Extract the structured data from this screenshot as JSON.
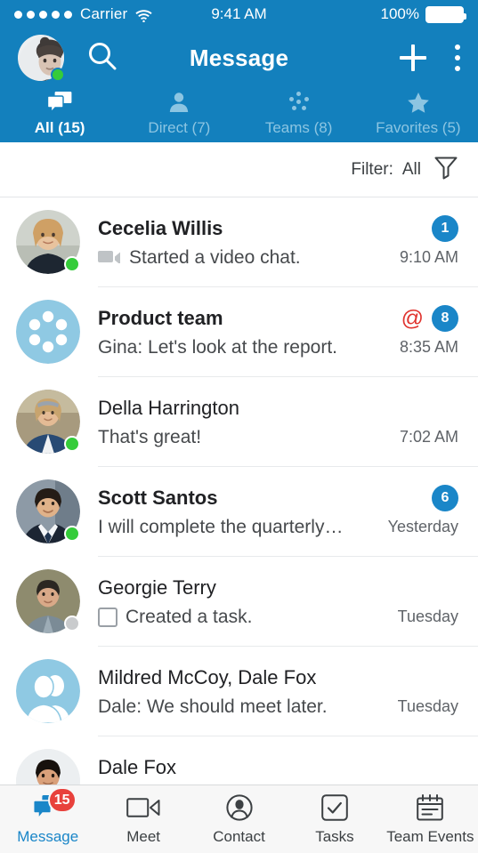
{
  "status_bar": {
    "carrier": "Carrier",
    "signal_dots": 5,
    "wifi_icon": "wifi-icon",
    "time": "9:41 AM",
    "battery_percent": "100%",
    "battery_icon": "battery-full-icon"
  },
  "header": {
    "title": "Message",
    "avatar_name": "user-avatar",
    "avatar_presence": "online",
    "search_icon": "search-icon",
    "add_icon": "plus-icon",
    "overflow_icon": "kebab-menu-icon",
    "background_color": "#1380bd"
  },
  "segment_tabs": [
    {
      "label": "All (15)",
      "icon": "chat-bubbles-icon",
      "active": true
    },
    {
      "label": "Direct (7)",
      "icon": "person-icon",
      "active": false
    },
    {
      "label": "Teams (8)",
      "icon": "team-dots-icon",
      "active": false
    },
    {
      "label": "Favorites (5)",
      "icon": "star-icon",
      "active": false
    }
  ],
  "filter_bar": {
    "label": "Filter:",
    "value": "All",
    "icon": "funnel-icon"
  },
  "conversations": [
    {
      "name": "Cecelia Willis",
      "preview": "Started a video chat.",
      "time": "9:10 AM",
      "badge": "1",
      "mention": false,
      "unread": true,
      "avatar_type": "photo-woman-blonde",
      "presence": "online",
      "preview_icon": "video-camera-icon"
    },
    {
      "name": "Product team",
      "preview": "Gina: Let's look at the report.",
      "time": "8:35 AM",
      "badge": "8",
      "mention": true,
      "mention_symbol": "@",
      "unread": true,
      "avatar_type": "team-dots",
      "presence": "none",
      "preview_icon": "none"
    },
    {
      "name": "Della Harrington",
      "preview": "That's great!",
      "time": "7:02 AM",
      "badge": "",
      "mention": false,
      "unread": false,
      "avatar_type": "photo-woman-outdoor",
      "presence": "online",
      "preview_icon": "none"
    },
    {
      "name": "Scott Santos",
      "preview": "I will complete the quarterly…",
      "time": "Yesterday",
      "badge": "6",
      "mention": false,
      "unread": true,
      "avatar_type": "photo-man-suit",
      "presence": "online",
      "preview_icon": "none"
    },
    {
      "name": "Georgie Terry",
      "preview": "Created a task.",
      "time": "Tuesday",
      "badge": "",
      "mention": false,
      "unread": false,
      "avatar_type": "photo-man-casual",
      "presence": "offline",
      "preview_icon": "checkbox-icon"
    },
    {
      "name": "Mildred McCoy, Dale Fox",
      "preview": "Dale: We should meet later.",
      "time": "Tuesday",
      "badge": "",
      "mention": false,
      "unread": false,
      "avatar_type": "group-silhouette",
      "presence": "none",
      "preview_icon": "none"
    },
    {
      "name": "Dale Fox",
      "preview": "",
      "time": "",
      "badge": "",
      "mention": false,
      "unread": false,
      "avatar_type": "photo-man-dark",
      "presence": "none",
      "preview_icon": "none"
    }
  ],
  "bottom_tabs": [
    {
      "label": "Message",
      "icon": "message-bubbles-icon",
      "badge": "15",
      "active": true
    },
    {
      "label": "Meet",
      "icon": "video-camera-icon",
      "badge": "",
      "active": false
    },
    {
      "label": "Contact",
      "icon": "contact-person-icon",
      "badge": "",
      "active": false
    },
    {
      "label": "Tasks",
      "icon": "checkmark-square-icon",
      "badge": "",
      "active": false
    },
    {
      "label": "Team Events",
      "icon": "calendar-icon",
      "badge": "",
      "active": false
    }
  ],
  "colors": {
    "brand_blue": "#1380bd",
    "badge_blue": "#1a86c8",
    "mention_red": "#e0342f",
    "notification_red": "#e8413c",
    "presence_green": "#35cc3a",
    "avatar_light_blue": "#8fc9e3"
  }
}
